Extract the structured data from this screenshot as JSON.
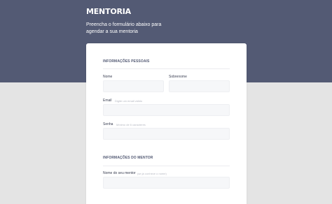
{
  "brand": {
    "logo": "MENTORIA"
  },
  "header": {
    "subtitle": "Preencha o formulário abaixo para agendar a sua mentoria"
  },
  "form": {
    "personal": {
      "title": "INFORMAÇÕES PESSOAIS",
      "name": {
        "label": "Nome",
        "value": ""
      },
      "surname": {
        "label": "Sobrenome",
        "value": ""
      },
      "email": {
        "label": "Email",
        "hint": "Digite um email válido",
        "value": ""
      },
      "password": {
        "label": "Senha",
        "hint": "Mínimo de 6 caracteres",
        "value": ""
      }
    },
    "mentor": {
      "title": "INFORMAÇÕES DO MENTOR",
      "mentor_name": {
        "label": "Nome do seu mentor",
        "hint": "(se já conhece o nome)",
        "value": ""
      }
    }
  },
  "colors": {
    "hero_bg": "#535a74",
    "page_bg": "#e4e4e4",
    "card_bg": "#ffffff",
    "field_bg": "#f6f7f9"
  }
}
